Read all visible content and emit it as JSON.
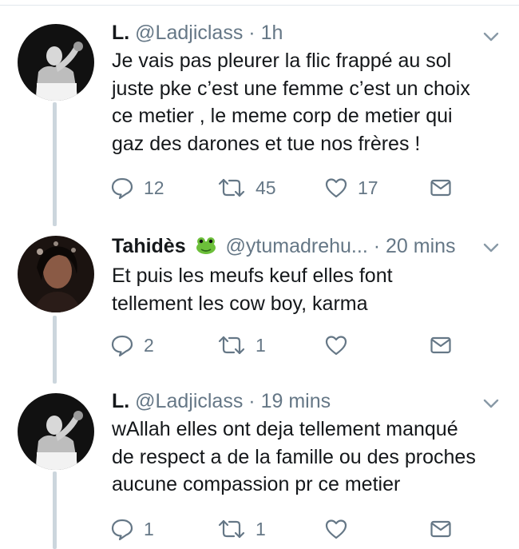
{
  "tweets": [
    {
      "name": "L.",
      "handle": "@Ladjiclass",
      "separator": "·",
      "time": "1h",
      "lines": [
        "Je vais pas pleurer la flic frappé au sol",
        "juste pke c’est une femme c’est un choix",
        "ce metier , le meme corp de metier qui",
        "gaz des darones et tue nos frères !"
      ],
      "replies": "12",
      "retweets": "45",
      "likes": "17"
    },
    {
      "name": "Tahidès",
      "emoji": "frog-emoji",
      "handle": "@ytumadrehu...",
      "separator": "·",
      "time": "20 mins",
      "lines": [
        "Et puis les meufs keuf elles font",
        "tellement les cow boy, karma"
      ],
      "replies": "2",
      "retweets": "1",
      "likes": ""
    },
    {
      "name": "L.",
      "handle": "@Ladjiclass",
      "separator": "·",
      "time": "19 mins",
      "lines": [
        "wAllah elles ont deja tellement manqué",
        "de respect a de la famille ou des proches",
        "aucune compassion pr ce metier"
      ],
      "replies": "1",
      "retweets": "1",
      "likes": ""
    }
  ],
  "icons": [
    "reply-icon",
    "retweet-icon",
    "like-icon",
    "dm-icon",
    "chevron-down-icon"
  ],
  "colors": {
    "text": "#14171a",
    "secondary": "#657786",
    "thread_line": "#ccd6dd"
  }
}
